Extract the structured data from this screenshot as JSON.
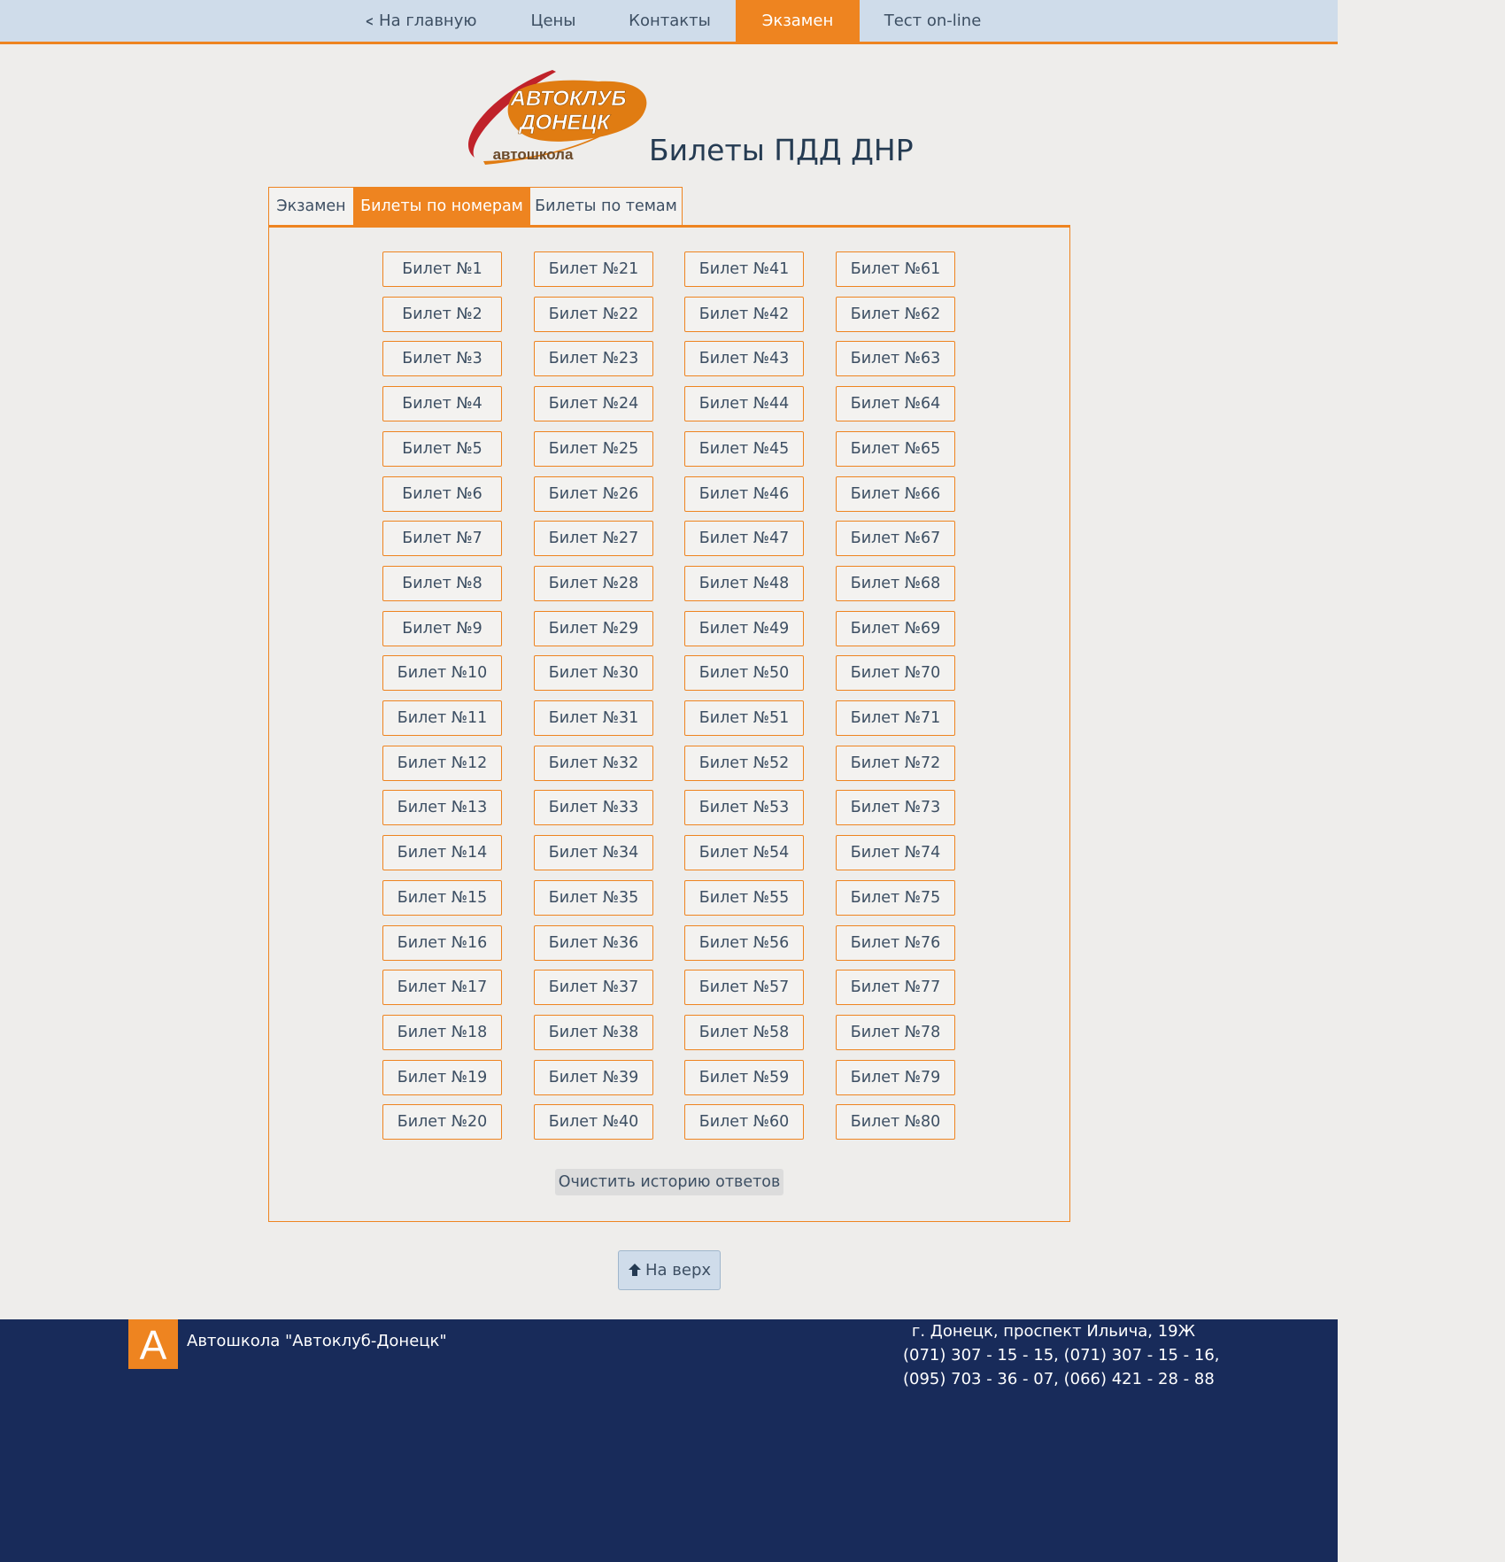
{
  "nav": {
    "items": [
      {
        "label": "На главную",
        "icon": "chevron-left-icon"
      },
      {
        "label": "Цены"
      },
      {
        "label": "Контакты"
      },
      {
        "label": "Экзамен",
        "active": true
      },
      {
        "label": "Тест on-line"
      }
    ]
  },
  "logo": {
    "line1": "АВТОКЛУБ",
    "line2": "ДОНЕЦК",
    "line3": "автошкола"
  },
  "page": {
    "title": "Билеты ПДД ДНР"
  },
  "tabs": [
    {
      "label": "Экзамен"
    },
    {
      "label": "Билеты по номерам",
      "active": true
    },
    {
      "label": "Билеты по темам"
    }
  ],
  "ticket_prefix": "Билет №",
  "tickets": [
    1,
    2,
    3,
    4,
    5,
    6,
    7,
    8,
    9,
    10,
    11,
    12,
    13,
    14,
    15,
    16,
    17,
    18,
    19,
    20,
    21,
    22,
    23,
    24,
    25,
    26,
    27,
    28,
    29,
    30,
    31,
    32,
    33,
    34,
    35,
    36,
    37,
    38,
    39,
    40,
    41,
    42,
    43,
    44,
    45,
    46,
    47,
    48,
    49,
    50,
    51,
    52,
    53,
    54,
    55,
    56,
    57,
    58,
    59,
    60,
    61,
    62,
    63,
    64,
    65,
    66,
    67,
    68,
    69,
    70,
    71,
    72,
    73,
    74,
    75,
    76,
    77,
    78,
    79,
    80
  ],
  "actions": {
    "clear_history": "Очистить историю ответов",
    "to_top": "На верх",
    "to_top_icon": "arrow-up-icon"
  },
  "footer": {
    "logo_letter": "А",
    "name": "Автошкола \"Автоклуб-Донецк\"",
    "address": "г. Донецк, проспект Ильича, 19Ж",
    "phones1": "(071) 307 - 15 - 15, (071) 307 - 15 - 16,",
    "phones2": "(095) 703 - 36 - 07, (066) 421 - 28 - 88"
  },
  "colors": {
    "accent": "#ee8420",
    "nav_bg": "#cfdcea",
    "footer_bg": "#182b5a",
    "page_bg": "#eeedeb"
  }
}
